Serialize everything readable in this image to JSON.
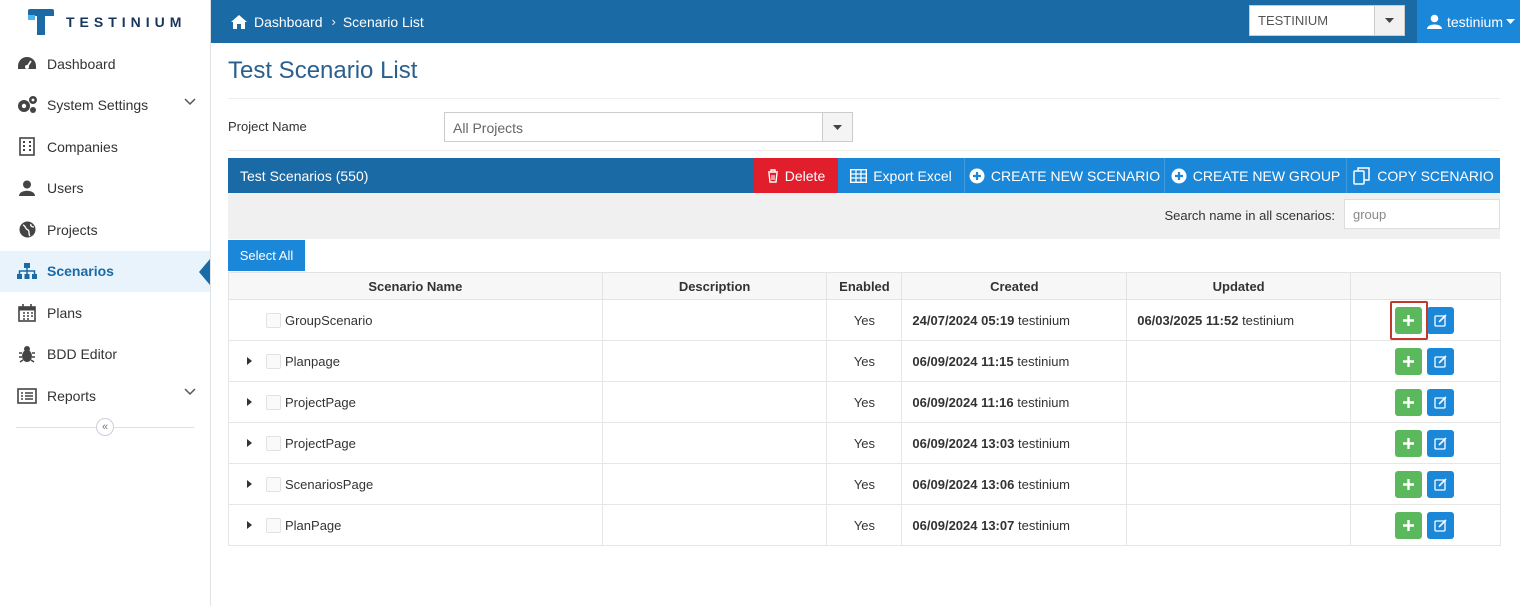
{
  "brand": {
    "name": "TESTINIUM"
  },
  "breadcrumb": {
    "home": "Dashboard",
    "current": "Scenario List"
  },
  "header": {
    "workspace": "TESTINIUM",
    "user": "testinium"
  },
  "sidebar": {
    "items": [
      {
        "label": "Dashboard",
        "icon": "dashboard-icon"
      },
      {
        "label": "System Settings",
        "icon": "gears-icon",
        "expandable": true
      },
      {
        "label": "Companies",
        "icon": "building-icon"
      },
      {
        "label": "Users",
        "icon": "user-icon"
      },
      {
        "label": "Projects",
        "icon": "globe-icon"
      },
      {
        "label": "Scenarios",
        "icon": "sitemap-icon",
        "active": true
      },
      {
        "label": "Plans",
        "icon": "calendar-icon"
      },
      {
        "label": "BDD Editor",
        "icon": "bug-icon"
      },
      {
        "label": "Reports",
        "icon": "list-icon",
        "expandable": true
      }
    ],
    "collapse_glyph": "«"
  },
  "page": {
    "title": "Test Scenario List"
  },
  "filter": {
    "label": "Project Name",
    "value": "All Projects"
  },
  "panel": {
    "title": "Test Scenarios (550)",
    "buttons": {
      "delete": "Delete",
      "export": "Export Excel",
      "create_scenario": "CREATE NEW SCENARIO",
      "create_group": "CREATE NEW GROUP",
      "copy": "COPY SCENARIO"
    }
  },
  "search": {
    "label": "Search name in all scenarios:",
    "value": "group"
  },
  "select_all": "Select All",
  "table": {
    "headers": [
      "Scenario Name",
      "Description",
      "Enabled",
      "Created",
      "Updated",
      ""
    ],
    "rows": [
      {
        "name": "GroupScenario",
        "expandable": false,
        "description": "",
        "enabled": "Yes",
        "created_date": "24/07/2024 05:19",
        "created_by": "testinium",
        "updated_date": "06/03/2025 11:52",
        "updated_by": "testinium"
      },
      {
        "name": "Planpage",
        "expandable": true,
        "description": "",
        "enabled": "Yes",
        "created_date": "06/09/2024 11:15",
        "created_by": "testinium",
        "updated_date": "",
        "updated_by": ""
      },
      {
        "name": "ProjectPage",
        "expandable": true,
        "description": "",
        "enabled": "Yes",
        "created_date": "06/09/2024 11:16",
        "created_by": "testinium",
        "updated_date": "",
        "updated_by": ""
      },
      {
        "name": "ProjectPage",
        "expandable": true,
        "description": "",
        "enabled": "Yes",
        "created_date": "06/09/2024 13:03",
        "created_by": "testinium",
        "updated_date": "",
        "updated_by": ""
      },
      {
        "name": "ScenariosPage",
        "expandable": true,
        "description": "",
        "enabled": "Yes",
        "created_date": "06/09/2024 13:06",
        "created_by": "testinium",
        "updated_date": "",
        "updated_by": ""
      },
      {
        "name": "PlanPage",
        "expandable": true,
        "description": "",
        "enabled": "Yes",
        "created_date": "06/09/2024 13:07",
        "created_by": "testinium",
        "updated_date": "",
        "updated_by": ""
      }
    ]
  },
  "colors": {
    "primary": "#1a6aa6",
    "accent": "#1b87d8",
    "danger": "#e01e2c",
    "success": "#5cb85c",
    "highlight": "#c0392b"
  }
}
